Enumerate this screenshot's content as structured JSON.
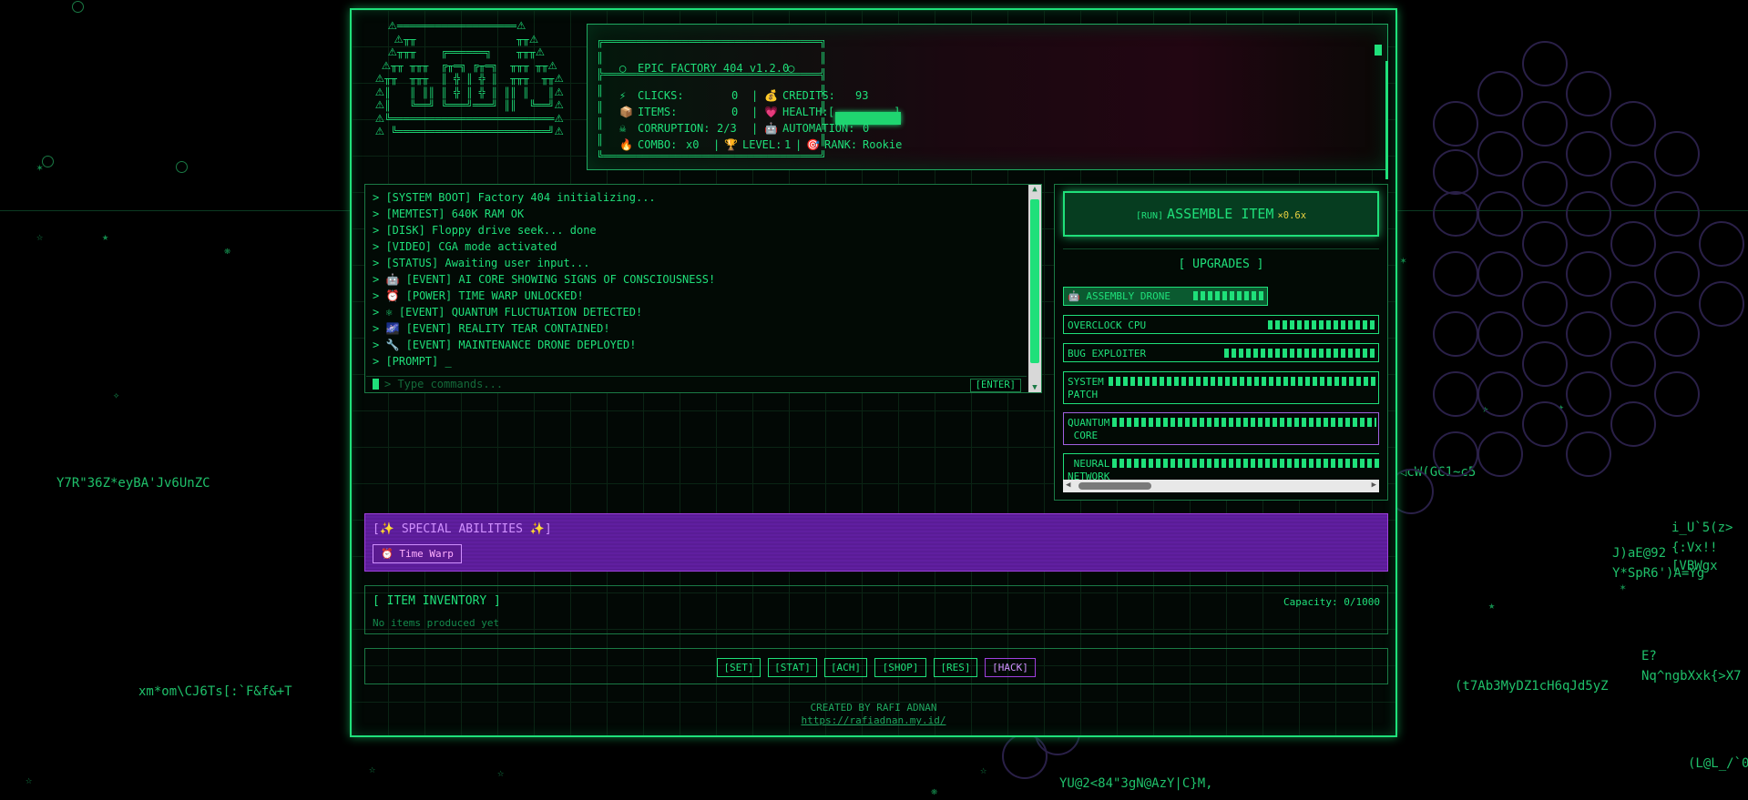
{
  "app": {
    "title": "EPIC FACTORY 404 v1.2.0",
    "credit": "CREATED BY RAFI ADNAN",
    "link": "https://rafiadnan.my.id/"
  },
  "stats": {
    "clicks_label": "CLICKS:",
    "clicks": "0",
    "credits_label": "CREDITS:",
    "credits": "93",
    "items_label": "ITEMS:",
    "items": "0",
    "health_label": "HEALTH:",
    "health_fraction": 1.0,
    "corruption_label": "CORRUPTION:",
    "corruption": "2/3",
    "automation_label": "AUTOMATION:",
    "automation": "0",
    "combo_label": "COMBO:",
    "combo": "x0",
    "level_label": "LEVEL:",
    "level": "1",
    "rank_label": "RANK:",
    "rank": "Rookie"
  },
  "log": [
    "> [SYSTEM BOOT] Factory 404 initializing...",
    "> [MEMTEST] 640K RAM OK",
    "> [DISK] Floppy drive seek... done",
    "> [VIDEO] CGA mode activated",
    "> [STATUS] Awaiting user input...",
    "> 🤖 [EVENT] AI CORE SHOWING SIGNS OF CONSCIOUSNESS!",
    "> ⏰ [POWER] TIME WARP UNLOCKED!",
    "> ⚛ [EVENT] QUANTUM FLUCTUATION DETECTED!",
    "> 🌌 [EVENT] REALITY TEAR CONTAINED!",
    "> 🔧 [EVENT] MAINTENANCE DRONE DEPLOYED!",
    "> [PROMPT] _"
  ],
  "command": {
    "placeholder": "> Type commands...",
    "enter": "[ENTER]"
  },
  "assemble": {
    "run": "[RUN]",
    "label": "ASSEMBLE ITEM",
    "mult": "×0.6x"
  },
  "upgrades": {
    "title": "[ UPGRADES ]",
    "drone": "🤖 ASSEMBLY DRONE",
    "items": [
      "OVERCLOCK CPU",
      "BUG EXPLOITER",
      "SYSTEM\nPATCH",
      "QUANTUM\n CORE",
      " NEURAL\nNETWORK"
    ]
  },
  "abilities": {
    "title": "[✨ SPECIAL ABILITIES ✨]",
    "time_warp": "⏰ Time Warp"
  },
  "inventory": {
    "title": "[ ITEM INVENTORY ]",
    "capacity": "Capacity: 0/1000",
    "empty": "No items produced yet"
  },
  "nav": [
    "[SET]",
    "[STAT]",
    "[ACH]",
    "[SHOP]",
    "[RES]",
    "[HACK]"
  ],
  "background_text": [
    "Y7R\"36Z*eyBA'Jv6UnZC",
    "xm*om\\CJ6Ts[:`F&f&+T",
    "YU@2<84\"3gN@AzY|C}M,",
    "(t7Ab3MyDZ1cH6qJd5yZ",
    "◁cW(GC1~c5",
    "i_U`5(z>",
    "{:Vx!!",
    "J)aE@92",
    "[VBWgx",
    "Y*SpR6')A=Yg",
    "E?",
    "Nq^ngbXxk{>X7",
    "(L@L_/`0"
  ],
  "colors": {
    "accent": "#1fe07a",
    "purple": "#5a1c96",
    "bg": "#000000"
  }
}
